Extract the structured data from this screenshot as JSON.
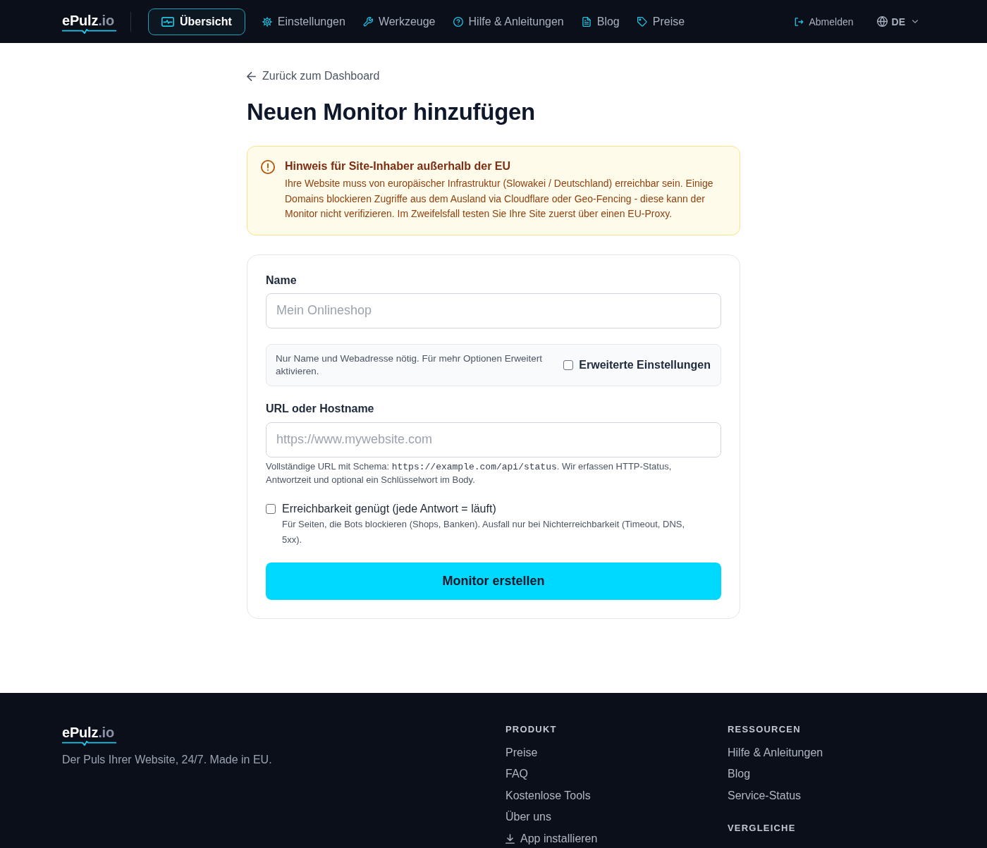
{
  "header": {
    "logo": {
      "name": "ePulz",
      "suffix": ".io"
    },
    "nav": [
      {
        "label": "Übersicht",
        "selected": true
      },
      {
        "label": "Einstellungen",
        "selected": false
      },
      {
        "label": "Werkzeuge",
        "selected": false
      },
      {
        "label": "Hilfe & Anleitungen",
        "selected": false
      },
      {
        "label": "Blog",
        "selected": false
      },
      {
        "label": "Preise",
        "selected": false
      }
    ],
    "logout": {
      "label": "Abmelden"
    },
    "language": {
      "label": "DE"
    }
  },
  "back_link": {
    "label": "Zurück zum Dashboard"
  },
  "title": "Neuen Monitor hinzufügen",
  "notice": {
    "title": "Hinweis für Site-Inhaber außerhalb der EU",
    "text": "Ihre Website muss von europäischer Infrastruktur (Slowakei / Deutschland) erreichbar sein. Einige Domains blockieren Zugriffe aus dem Ausland via Cloudflare oder Geo-Fencing - diese kann der Monitor nicht verifizieren. Im Zweifelsfall testen Sie Ihre Site zuerst über einen EU-Proxy."
  },
  "form": {
    "name_field": {
      "label": "Name",
      "placeholder": "Mein Onlineshop"
    },
    "advanced": {
      "hint": "Nur Name und Webadresse nötig. Für mehr Optionen Erweitert aktivieren.",
      "label": "Erweiterte Einstellungen",
      "checked": false
    },
    "url_field": {
      "label": "URL oder Hostname",
      "placeholder": "https://www.mywebsite.com",
      "hint": [
        {
          "kind": "text",
          "text": "Vollständige URL mit Schema: "
        },
        {
          "kind": "code",
          "text": "https://example.com/api/status"
        },
        {
          "kind": "text",
          "text": ". Wir erfassen HTTP-Status, Antwortzeit und optional ein Schlüsselwort im Body."
        }
      ]
    },
    "reachability": {
      "label": "Erreichbarkeit genügt (jede Antwort = läuft)",
      "description": "Für Seiten, die Bots blockieren (Shops, Banken). Ausfall nur bei Nichterreichbarkeit (Timeout, DNS, 5xx).",
      "checked": false
    },
    "submit": {
      "label": "Monitor erstellen"
    }
  },
  "footer": {
    "logo": {
      "name": "ePulz",
      "suffix": ".io"
    },
    "tagline": "Der Puls Ihrer Website, 24/7. Made in EU.",
    "columns": [
      {
        "sections": [
          {
            "heading": "PRODUKT",
            "links": [
              {
                "kind": "link",
                "label": "Preise"
              },
              {
                "kind": "link",
                "label": "FAQ"
              },
              {
                "kind": "link",
                "label": "Kostenlose Tools"
              },
              {
                "kind": "link",
                "label": "Über uns"
              },
              {
                "kind": "download",
                "label": "App installieren"
              }
            ]
          }
        ]
      },
      {
        "sections": [
          {
            "heading": "RESSOURCEN",
            "links": [
              {
                "kind": "link",
                "label": "Hilfe & Anleitungen"
              },
              {
                "kind": "link",
                "label": "Blog"
              },
              {
                "kind": "link",
                "label": "Service-Status"
              }
            ]
          },
          {
            "heading": "VERGLEICHE"
          }
        ]
      }
    ]
  }
}
